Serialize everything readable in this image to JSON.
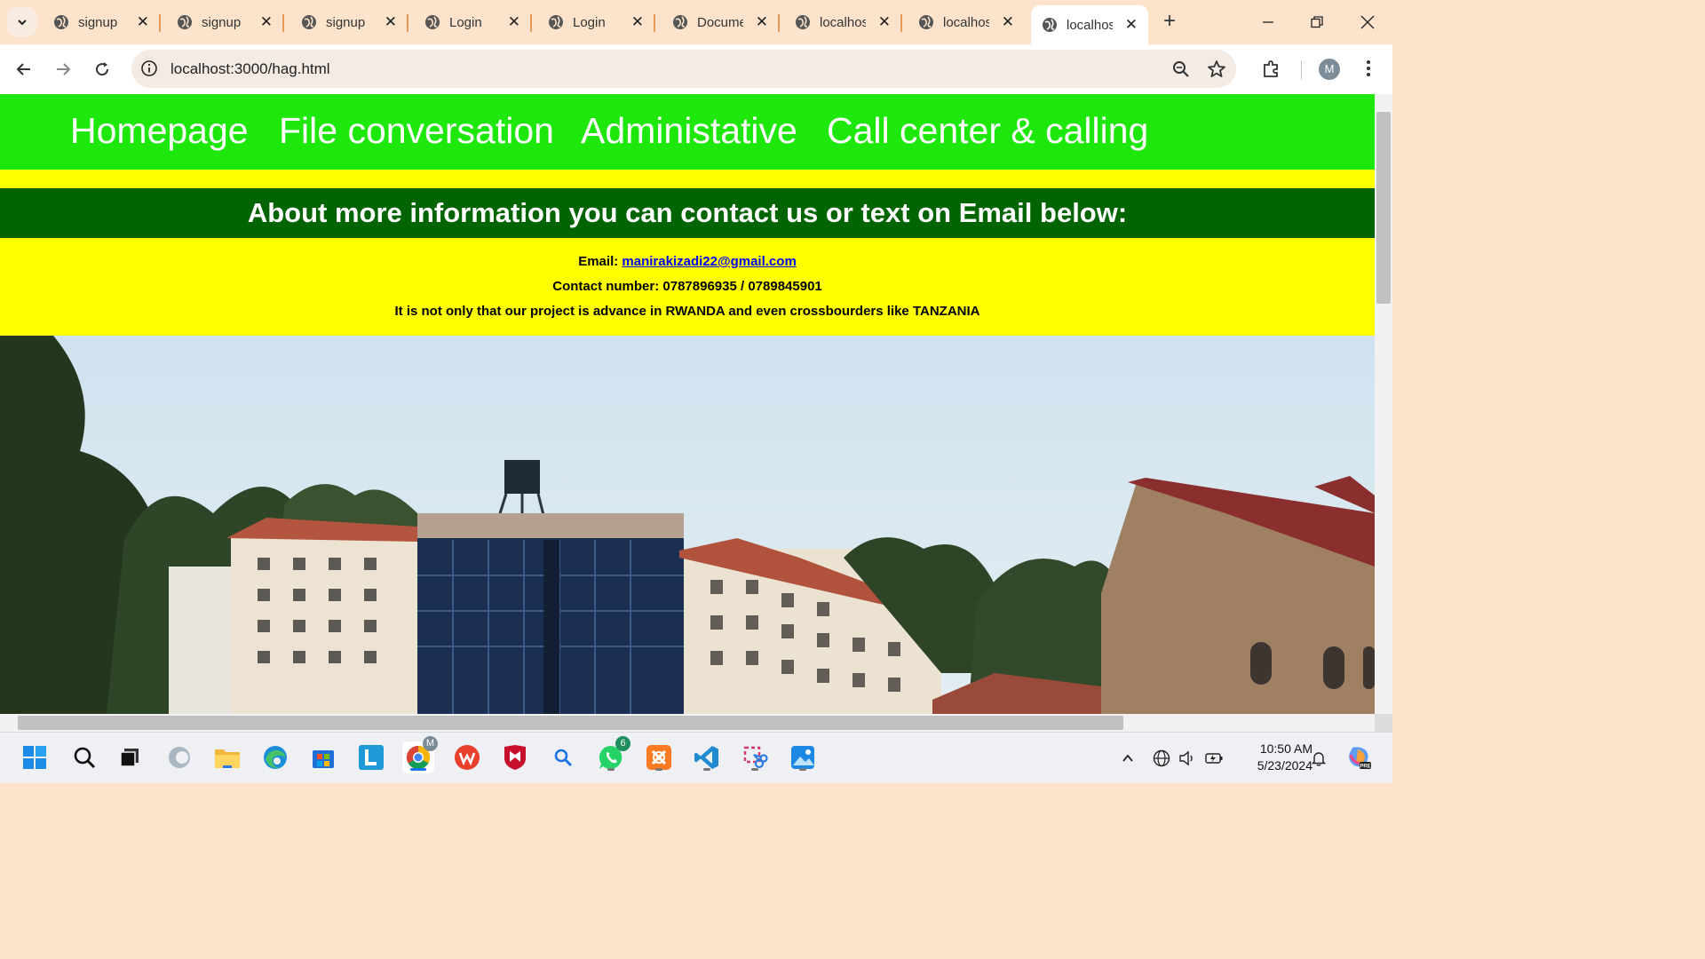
{
  "browser": {
    "tabs": [
      {
        "title": "signup"
      },
      {
        "title": "signup"
      },
      {
        "title": "signup"
      },
      {
        "title": "Login"
      },
      {
        "title": "Login"
      },
      {
        "title": "Docume"
      },
      {
        "title": "localhos"
      },
      {
        "title": "localhos"
      },
      {
        "title": "localhos",
        "active": true
      }
    ],
    "url": "localhost:3000/hag.html",
    "profile_initial": "M"
  },
  "page": {
    "nav": [
      "Homepage",
      "File conversation",
      "Administative",
      "Call center & calling"
    ],
    "banner": "About more information you can contact us or text on Email below:",
    "email_label": "Email: ",
    "email": "manirakizadi22@gmail.com",
    "contact_number": "Contact number: 0787896935 / 0789845901",
    "note": "It is not only that our project is advance in RWANDA and even crossbourders like TANZANIA",
    "colors": {
      "nav": "#1ee80b",
      "banner": "#006400",
      "highlight": "#ffff00"
    }
  },
  "taskbar": {
    "time": "10:50 AM",
    "date": "5/23/2024",
    "whatsapp_badge": "6",
    "chrome_badge": "M",
    "apps": [
      "windows-start",
      "search",
      "task-view",
      "copilot",
      "file-explorer",
      "edge",
      "store",
      "l-app",
      "chrome",
      "wps",
      "mcafee",
      "search-app",
      "whatsapp",
      "xampp",
      "vscode",
      "snipping-tool",
      "photos"
    ]
  }
}
